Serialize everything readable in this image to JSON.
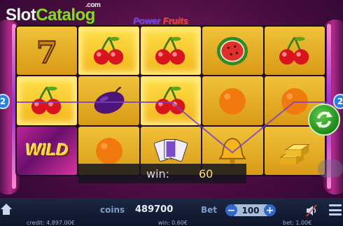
{
  "logo": {
    "slot": "Slot",
    "catalog": "Catalog",
    "com": ".com"
  },
  "game_title": {
    "part1": "Power",
    "part2": "Fruits"
  },
  "reels": {
    "rows": [
      [
        "seven",
        "cherry",
        "cherry",
        "watermelon",
        "cherry"
      ],
      [
        "cherry",
        "plum",
        "cherry",
        "orange",
        "orange"
      ],
      [
        "wild",
        "orange",
        "cards",
        "bell",
        "gold-bars"
      ]
    ],
    "winning_cells": [
      [
        0,
        1
      ],
      [
        0,
        2
      ],
      [
        1,
        0
      ],
      [
        1,
        2
      ]
    ],
    "wild_label": "WILD"
  },
  "line_markers": {
    "left": "2",
    "right": "2"
  },
  "win_bar": {
    "label": "win:",
    "value": "60"
  },
  "bottom_bar": {
    "coins_label": "coins",
    "coins_value": "489700",
    "bet_label": "Bet",
    "bet_value": "100",
    "bet_minus": "−",
    "bet_plus": "+",
    "credit_text": "credit: 4,897.00€",
    "win_text": "win: 0.60€",
    "bet_text": "bet: 1.00€"
  },
  "icons": {
    "home": "home-icon",
    "spin": "spin-arrows-icon",
    "sound": "speaker-icon",
    "menu": "hamburger-menu-icon"
  },
  "colors": {
    "accent_green": "#8fd42a",
    "spin_green": "#1d8a1c",
    "reel_gold": "#f0c23a",
    "bottom_bar": "#1d2742"
  }
}
